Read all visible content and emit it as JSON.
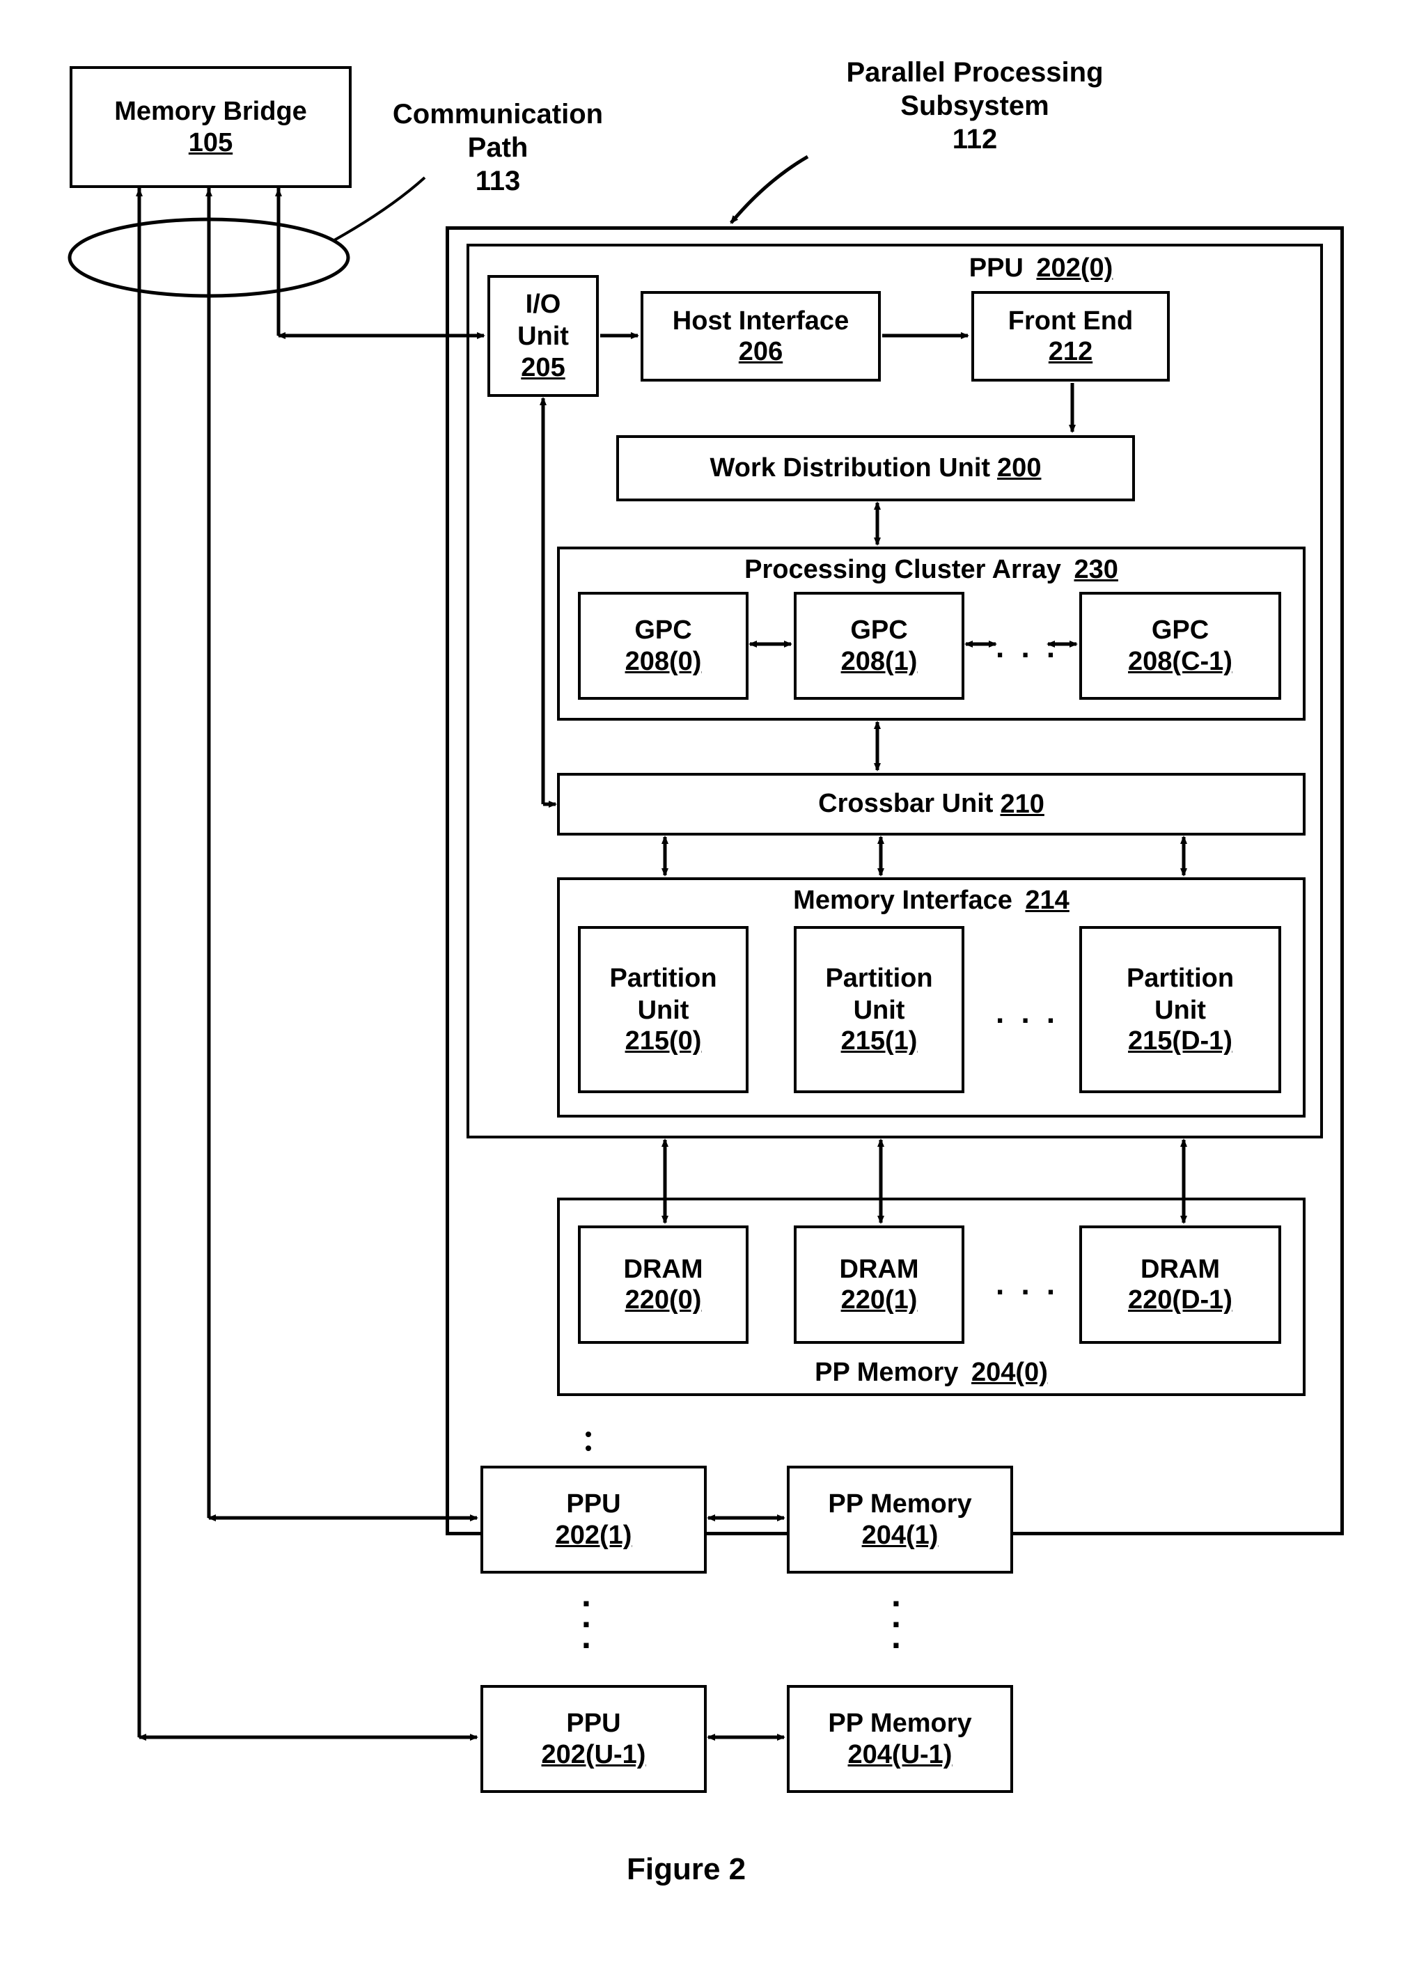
{
  "memory_bridge": {
    "label": "Memory Bridge",
    "num": "105"
  },
  "comm_path": {
    "label": "Communication\nPath",
    "num": "113"
  },
  "subsystem": {
    "label": "Parallel Processing\nSubsystem",
    "num": "112"
  },
  "ppu0": {
    "title_label": "PPU",
    "title_num": "202(0)",
    "io": {
      "label": "I/O\nUnit",
      "num": "205"
    },
    "host": {
      "label": "Host Interface",
      "num": "206"
    },
    "front": {
      "label": "Front End",
      "num": "212"
    },
    "wdu": {
      "label": "Work Distribution Unit",
      "num": "200"
    },
    "pca": {
      "title_label": "Processing Cluster Array",
      "title_num": "230",
      "gpc0": {
        "label": "GPC",
        "num": "208(0)"
      },
      "gpc1": {
        "label": "GPC",
        "num": "208(1)"
      },
      "gpcN": {
        "label": "GPC",
        "num": "208(C-1)"
      }
    },
    "crossbar": {
      "label": "Crossbar Unit",
      "num": "210"
    },
    "mi": {
      "title_label": "Memory Interface",
      "title_num": "214",
      "p0": {
        "label": "Partition\nUnit",
        "num": "215(0)"
      },
      "p1": {
        "label": "Partition\nUnit",
        "num": "215(1)"
      },
      "pN": {
        "label": "Partition\nUnit",
        "num": "215(D-1)"
      }
    }
  },
  "ppmem0": {
    "title_label": "PP Memory",
    "title_num": "204(0)",
    "d0": {
      "label": "DRAM",
      "num": "220(0)"
    },
    "d1": {
      "label": "DRAM",
      "num": "220(1)"
    },
    "dN": {
      "label": "DRAM",
      "num": "220(D-1)"
    }
  },
  "ppu1": {
    "label": "PPU",
    "num": "202(1)"
  },
  "ppmem1": {
    "label": "PP Memory",
    "num": "204(1)"
  },
  "ppuN": {
    "label": "PPU",
    "num": "202(U-1)"
  },
  "ppmemN": {
    "label": "PP Memory",
    "num": "204(U-1)"
  },
  "figure": "Figure 2",
  "ellipsis": ". . ."
}
